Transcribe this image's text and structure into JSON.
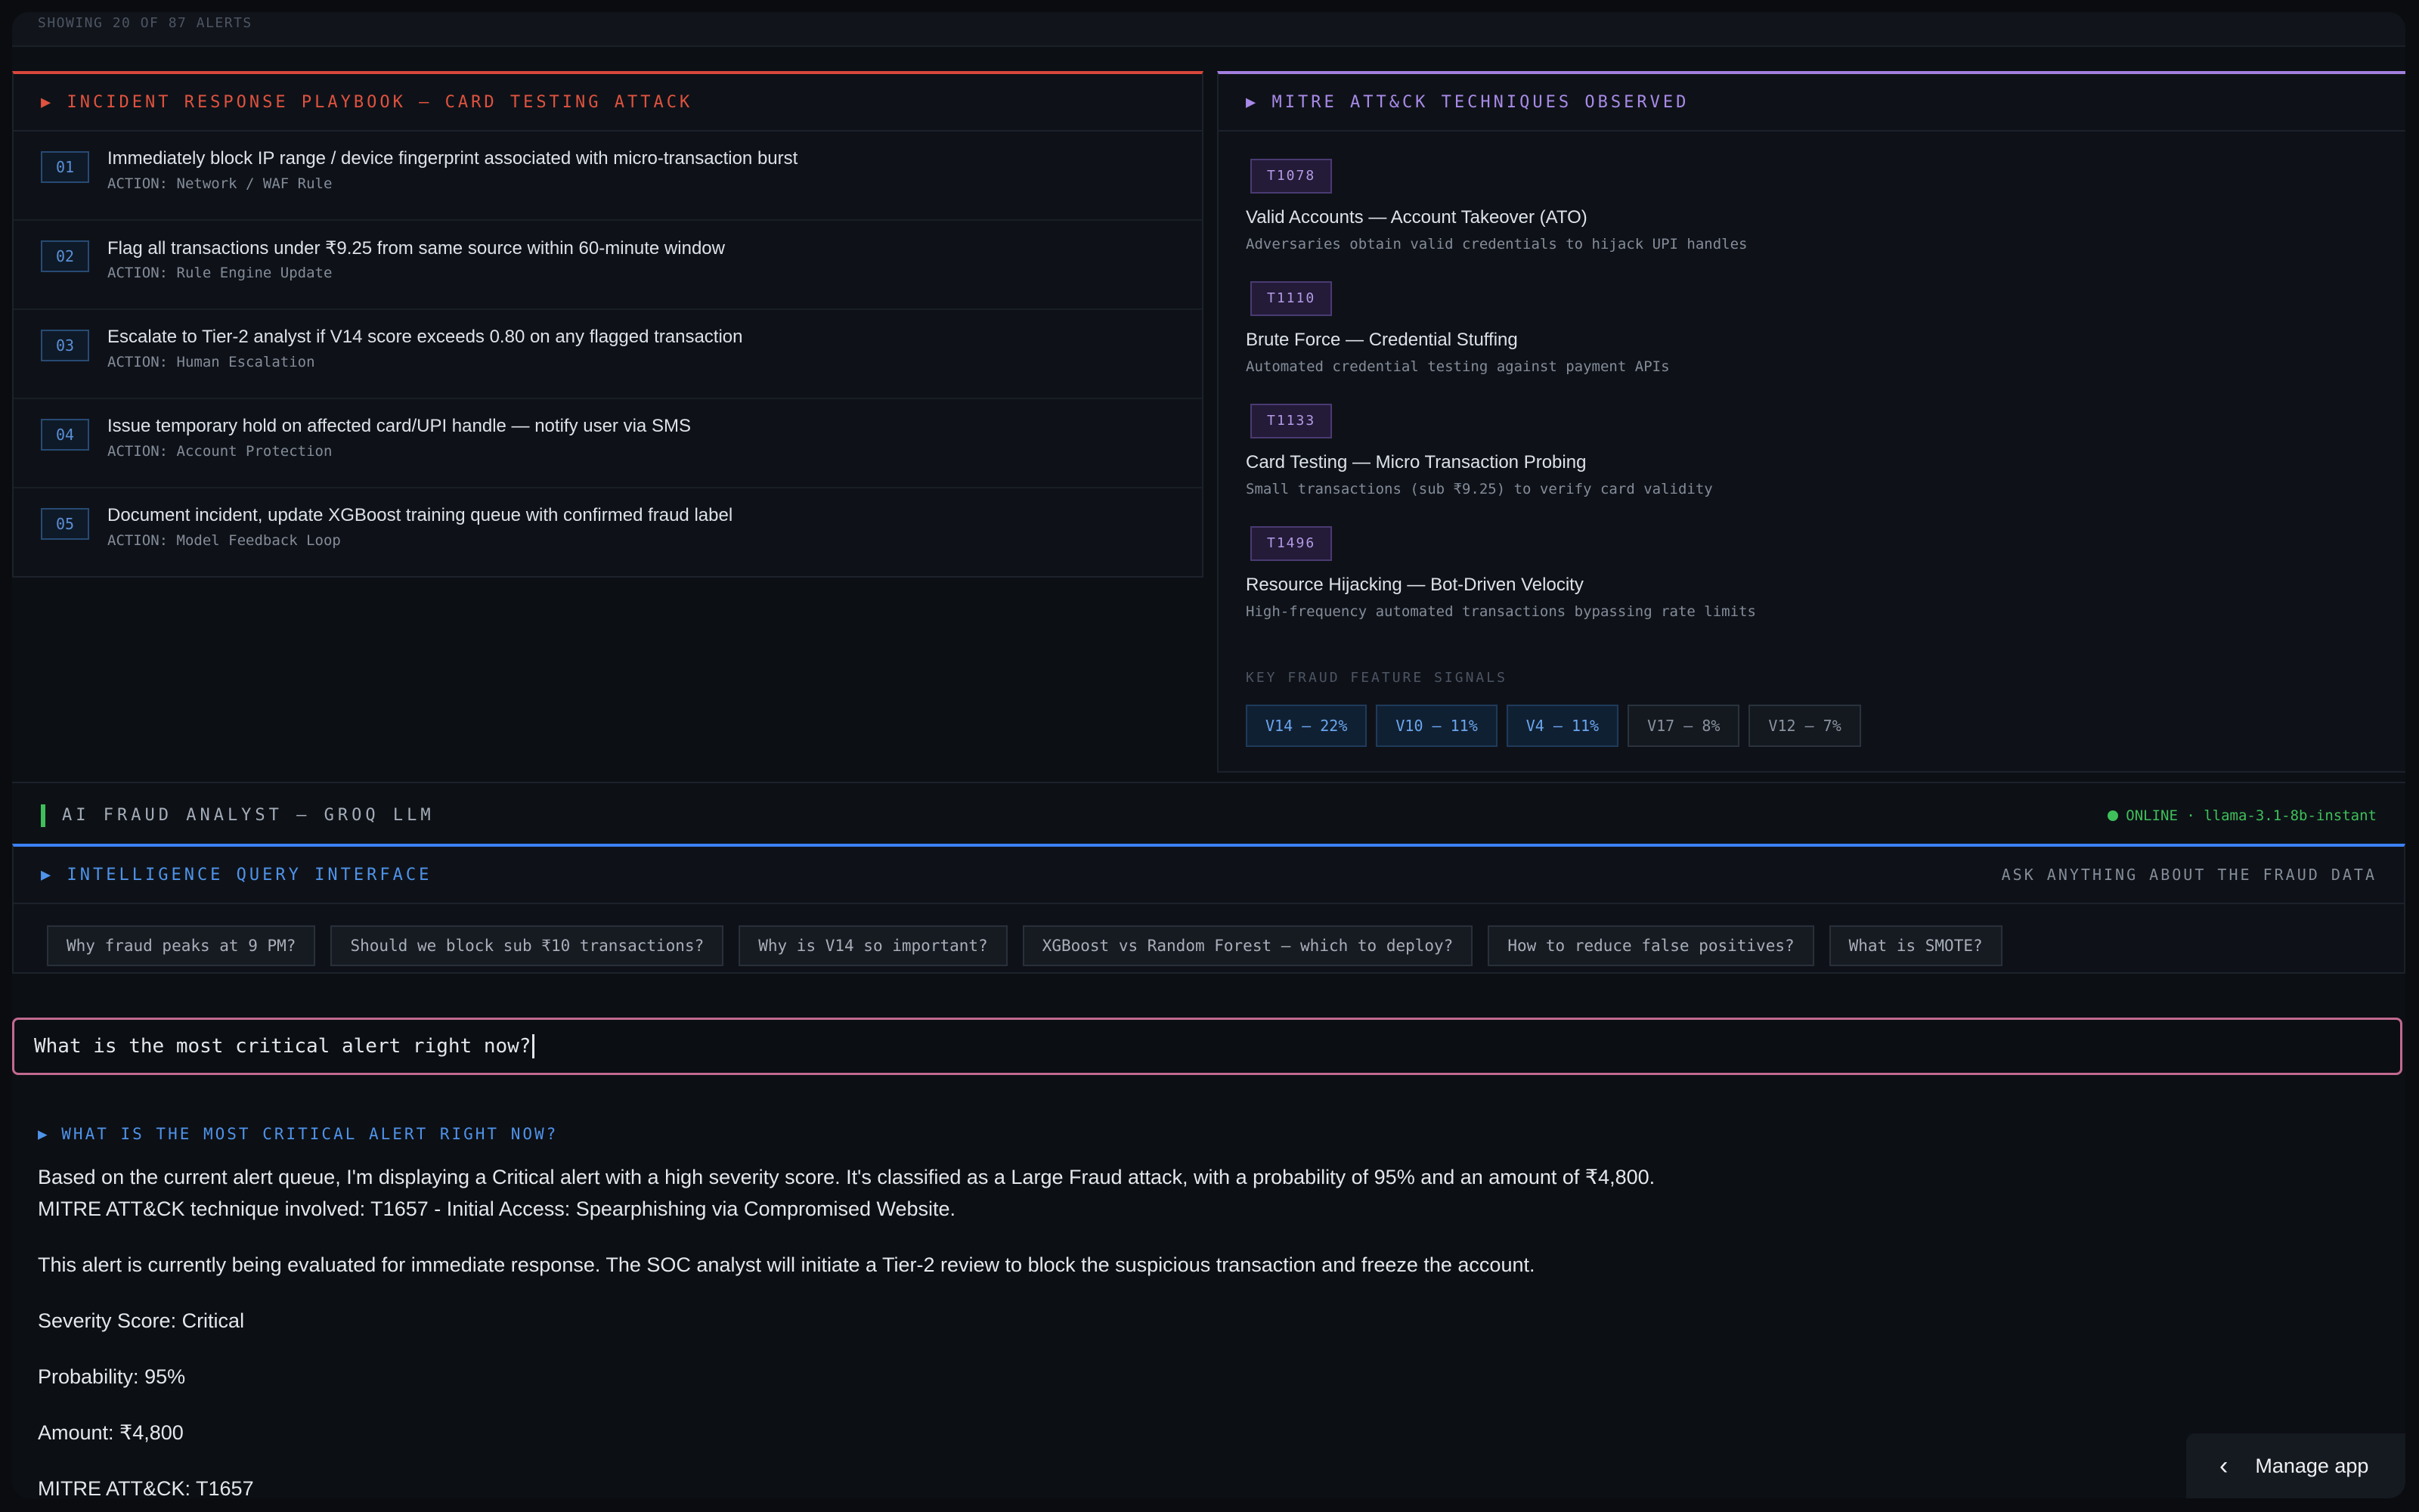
{
  "top_strip": {
    "text": "SHOWING 20 OF 87 ALERTS"
  },
  "playbook": {
    "title": "▶ INCIDENT RESPONSE PLAYBOOK — CARD TESTING ATTACK",
    "steps": [
      {
        "num": "01",
        "title": "Immediately block IP range / device fingerprint associated with micro-transaction burst",
        "action": "ACTION: Network / WAF Rule"
      },
      {
        "num": "02",
        "title": "Flag all transactions under ₹9.25 from same source within 60-minute window",
        "action": "ACTION: Rule Engine Update"
      },
      {
        "num": "03",
        "title": "Escalate to Tier-2 analyst if V14 score exceeds 0.80 on any flagged transaction",
        "action": "ACTION: Human Escalation"
      },
      {
        "num": "04",
        "title": "Issue temporary hold on affected card/UPI handle — notify user via SMS",
        "action": "ACTION: Account Protection"
      },
      {
        "num": "05",
        "title": "Document incident, update XGBoost training queue with confirmed fraud label",
        "action": "ACTION: Model Feedback Loop"
      }
    ]
  },
  "mitre": {
    "title": "▶ MITRE ATT&CK TECHNIQUES OBSERVED",
    "techniques": [
      {
        "id": "T1078",
        "name": "Valid Accounts — Account Takeover (ATO)",
        "desc": "Adversaries obtain valid credentials to hijack UPI handles"
      },
      {
        "id": "T1110",
        "name": "Brute Force — Credential Stuffing",
        "desc": "Automated credential testing against payment APIs"
      },
      {
        "id": "T1133",
        "name": "Card Testing — Micro Transaction Probing",
        "desc": "Small transactions (sub ₹9.25) to verify card validity"
      },
      {
        "id": "T1496",
        "name": "Resource Hijacking — Bot-Driven Velocity",
        "desc": "High-frequency automated transactions bypassing rate limits"
      }
    ],
    "signals_label": "KEY FRAUD FEATURE SIGNALS",
    "signals": [
      {
        "label": "V14 — 22%",
        "highlight": true
      },
      {
        "label": "V10 — 11%",
        "highlight": true
      },
      {
        "label": "V4 — 11%",
        "highlight": true
      },
      {
        "label": "V17 — 8%",
        "highlight": false
      },
      {
        "label": "V12 — 7%",
        "highlight": false
      }
    ]
  },
  "ai_bar": {
    "title": "AI FRAUD ANALYST — GROQ LLM",
    "status": "ONLINE · llama-3.1-8b-instant",
    "status_color": "#3fbf5a"
  },
  "query": {
    "title": "▶ INTELLIGENCE QUERY INTERFACE",
    "subtitle": "ASK ANYTHING ABOUT THE FRAUD DATA",
    "suggestions": [
      "Why fraud peaks at 9 PM?",
      "Should we block sub ₹10 transactions?",
      "Why is V14 so important?",
      "XGBoost vs Random Forest — which to deploy?",
      "How to reduce false positives?",
      "What is SMOTE?"
    ],
    "input_value": "What is the most critical alert right now?"
  },
  "response": {
    "heading": "▶ WHAT IS THE MOST CRITICAL ALERT RIGHT NOW?",
    "line1": "Based on the current alert queue, I'm displaying a Critical alert with a high severity score. It's classified as a Large Fraud attack, with a probability of 95% and an amount of ₹4,800.",
    "line2": "MITRE ATT&CK technique involved: T1657 - Initial Access: Spearphishing via Compromised Website.",
    "line3": "This alert is currently being evaluated for immediate response. The SOC analyst will initiate a Tier-2 review to block the suspicious transaction and freeze the account.",
    "line4": "Severity Score: Critical",
    "line5": "Probability: 95%",
    "line6": "Amount: ₹4,800",
    "line7": "MITRE ATT&CK: T1657"
  },
  "manage_app": {
    "label": "Manage app"
  },
  "colors": {
    "playbook_accent": "#d9463b",
    "mitre_accent": "#a37fe0",
    "query_accent": "#3b82f6",
    "input_border": "#c26a91"
  }
}
